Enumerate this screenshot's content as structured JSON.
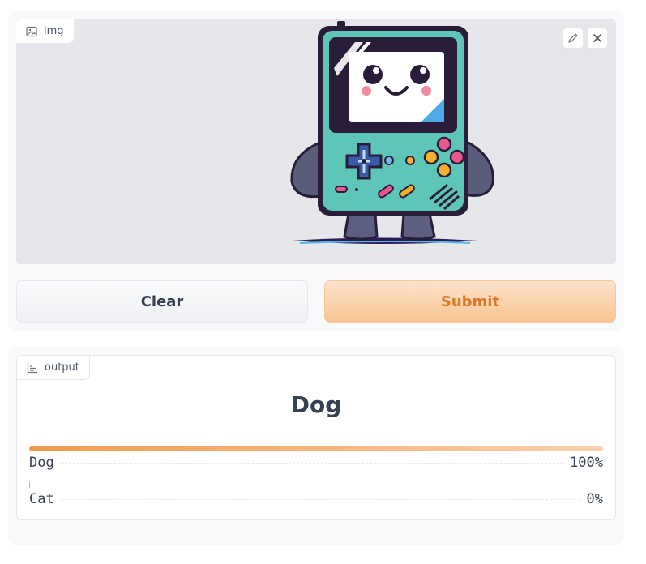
{
  "input": {
    "label": "img",
    "label_icon": "image-icon",
    "tools": [
      "edit-icon",
      "close-icon"
    ],
    "clear_label": "Clear",
    "submit_label": "Submit"
  },
  "output": {
    "label": "output",
    "label_icon": "bar-chart-icon",
    "predicted": "Dog",
    "confidences": [
      {
        "label": "Dog",
        "value": "100%",
        "fraction": 1.0
      },
      {
        "label": "Cat",
        "value": "0%",
        "fraction": 0.0
      }
    ]
  },
  "colors": {
    "accent": "#f59e42",
    "submit_text": "#d97a29"
  }
}
